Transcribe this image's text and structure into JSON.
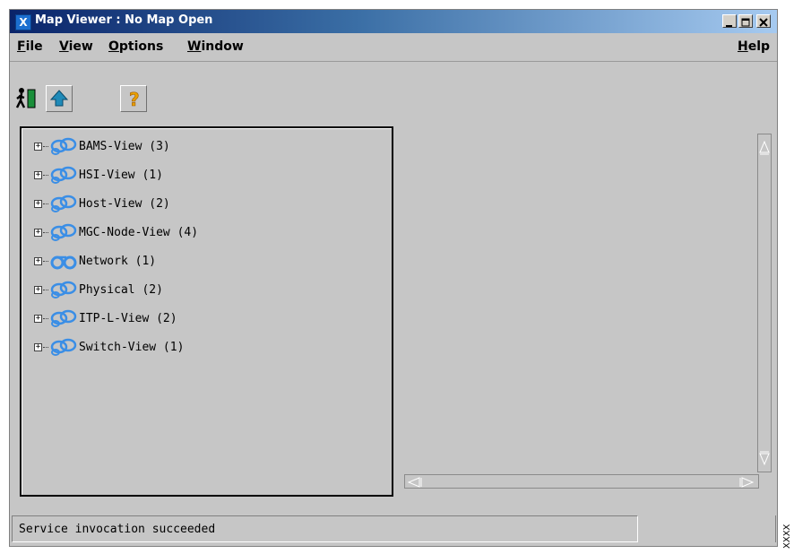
{
  "window": {
    "title": "Map Viewer : No Map Open",
    "app_icon_text": "X",
    "controls": [
      "minimize",
      "maximize",
      "close"
    ]
  },
  "menubar": {
    "items": [
      {
        "label": "File",
        "mnemonic": "F"
      },
      {
        "label": "View",
        "mnemonic": "V"
      },
      {
        "label": "Options",
        "mnemonic": "O"
      },
      {
        "label": "Window",
        "mnemonic": "W"
      },
      {
        "label": "Help",
        "mnemonic": "H"
      }
    ]
  },
  "toolbar": {
    "buttons": [
      {
        "icon": "exit-icon"
      },
      {
        "icon": "up-arrow-icon"
      },
      {
        "icon": "help-icon"
      }
    ]
  },
  "tree": {
    "nodes": [
      {
        "label": "BAMS-View (3)",
        "icon": "view-group-icon"
      },
      {
        "label": "HSI-View (1)",
        "icon": "view-group-icon"
      },
      {
        "label": "Host-View (2)",
        "icon": "view-group-icon"
      },
      {
        "label": "MGC-Node-View (4)",
        "icon": "view-group-icon"
      },
      {
        "label": "Network (1)",
        "icon": "network-icon"
      },
      {
        "label": "Physical (2)",
        "icon": "view-group-icon"
      },
      {
        "label": "ITP-L-View (2)",
        "icon": "view-group-icon"
      },
      {
        "label": "Switch-View (1)",
        "icon": "view-group-icon"
      }
    ]
  },
  "status": {
    "message": "Service invocation succeeded"
  },
  "side_tag": "XXXX",
  "colors": {
    "window_bg": "#c6c6c6",
    "title_gradient_start": "#0a246a",
    "title_gradient_end": "#a6caf0",
    "node_icon_blue": "#3a8ee6"
  }
}
